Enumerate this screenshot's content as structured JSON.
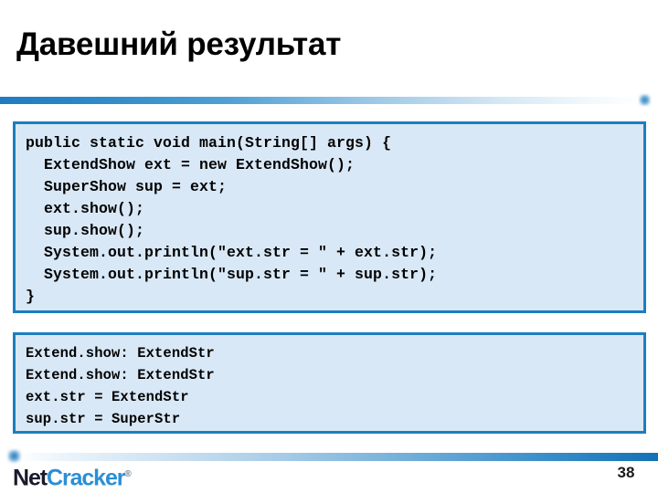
{
  "slide": {
    "title": "Давешний результат",
    "page_number": "38",
    "accent_color": "#1b7ebe",
    "code_bg_color": "#d9e8f6",
    "title_color": "#000000"
  },
  "code_block": {
    "language": "java",
    "lines": [
      "public static void main(String[] args) {",
      "  ExtendShow ext = new ExtendShow();",
      "  SuperShow sup = ext;",
      "  ext.show();",
      "  sup.show();",
      "  System.out.println(\"ext.str = \" + ext.str);",
      "  System.out.println(\"sup.str = \" + sup.str);",
      "}"
    ]
  },
  "output_block": {
    "lines": [
      "Extend.show: ExtendStr",
      "Extend.show: ExtendStr",
      "ext.str = ExtendStr",
      "sup.str = SuperStr"
    ]
  },
  "footer": {
    "logo_part1": "Net",
    "logo_part2": "Cracker",
    "logo_registered": "®",
    "logo_color_part1": "#1a1a2e",
    "logo_color_part2": "#2b8fd4"
  }
}
